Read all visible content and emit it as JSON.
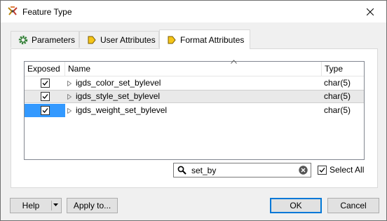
{
  "window": {
    "title": "Feature Type",
    "title_icon": "fme-icon",
    "close_icon": "close-icon"
  },
  "tabs": [
    {
      "label": "Parameters",
      "icon": "gear-icon",
      "active": false
    },
    {
      "label": "User Attributes",
      "icon": "attribute-arrow-icon",
      "active": false
    },
    {
      "label": "Format Attributes",
      "icon": "attribute-arrow-icon",
      "active": true
    }
  ],
  "table": {
    "columns": [
      "Exposed",
      "Name",
      "Type"
    ],
    "sorted_column": "Name",
    "rows": [
      {
        "exposed": true,
        "name": "igds_color_set_bylevel",
        "type": "char(5)"
      },
      {
        "exposed": true,
        "name": "igds_style_set_bylevel",
        "type": "char(5)"
      },
      {
        "exposed": true,
        "name": "igds_weight_set_bylevel",
        "type": "char(5)"
      }
    ]
  },
  "search": {
    "value": "set_by",
    "icon": "search-icon",
    "clear_icon": "clear-icon"
  },
  "select_all": {
    "label": "Select All",
    "checked": true
  },
  "buttons": {
    "help": "Help",
    "apply": "Apply to...",
    "ok": "OK",
    "cancel": "Cancel"
  },
  "colors": {
    "selection": "#3399ff",
    "accent": "#0078d7"
  }
}
